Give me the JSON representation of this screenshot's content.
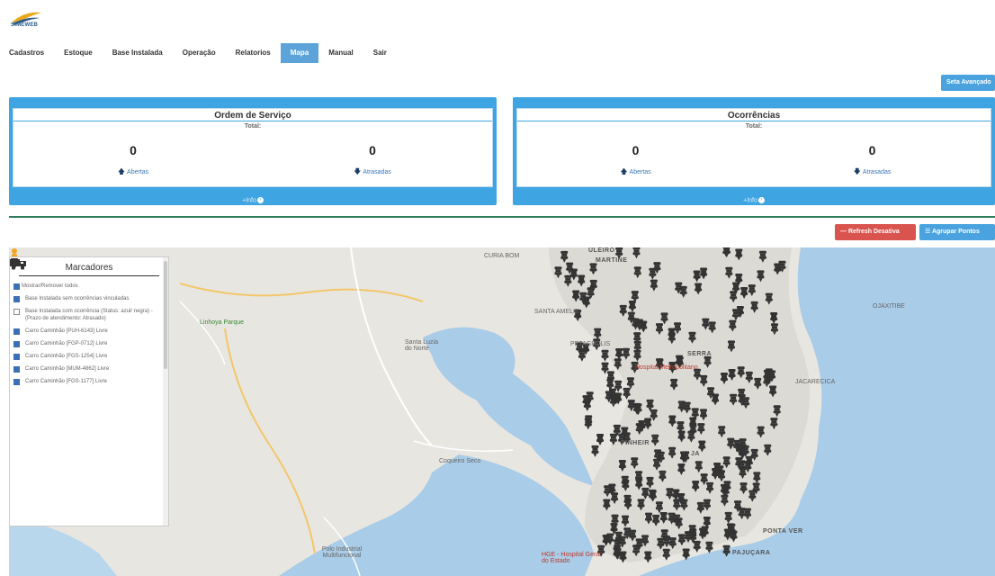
{
  "app": {
    "logo_text": "SIMEWEB"
  },
  "nav": {
    "items": [
      {
        "label": "Cadastros"
      },
      {
        "label": "Estoque"
      },
      {
        "label": "Base Instalada"
      },
      {
        "label": "Operação"
      },
      {
        "label": "Relatorios"
      },
      {
        "label": "Mapa",
        "active": true
      },
      {
        "label": "Manual"
      },
      {
        "label": "Sair"
      }
    ]
  },
  "buttons": {
    "advanced": "Seta Avançado",
    "refresh": "— Refresh Desativa",
    "group": "☰ Agrupar Pontos"
  },
  "ordem_servico": {
    "title": "Ordem de Serviço",
    "subtitle": "Total:",
    "abertas_value": "0",
    "abertas_label": "Abertas",
    "atrasadas_value": "0",
    "atrasadas_label": "Atrasadas",
    "footer": "+Info"
  },
  "ocorrencias": {
    "title": "Ocorrências",
    "subtitle": "Total:",
    "abertas_value": "0",
    "abertas_label": "Abertas",
    "atrasadas_value": "0",
    "atrasadas_label": "Atrasadas",
    "footer": "+Info"
  },
  "markers": {
    "title": "Marcadores",
    "items": [
      {
        "label": "Mostrar/Remover todos",
        "checked": true,
        "icon": "none"
      },
      {
        "label": "Base Instalada sem ocorrências vinculadas",
        "checked": true,
        "icon": "pin"
      },
      {
        "label": "Base Instalada com ocorrência (Status: azul/ negra) - (Prazo de atendimento: Atrasado)",
        "checked": false,
        "icon": "pin"
      },
      {
        "label": "Carro Caminhão [PUH-6143] Livre",
        "checked": true,
        "icon": "truck"
      },
      {
        "label": "Carro Caminhão [FGP-0712] Livre",
        "checked": true,
        "icon": "truck"
      },
      {
        "label": "Carro Caminhão [FGS-1254] Livre",
        "checked": true,
        "icon": "truck"
      },
      {
        "label": "Carro Caminhão [MUM-4862] Livre",
        "checked": true,
        "icon": "truck"
      },
      {
        "label": "Carro Caminhão [FGS-1177] Livre",
        "checked": true,
        "icon": "truck"
      }
    ]
  },
  "map": {
    "labels": [
      {
        "text": "CURIA BOM",
        "style": ""
      },
      {
        "text": "ULEIRO",
        "style": "bold"
      },
      {
        "text": "MARTINE",
        "style": "bold"
      },
      {
        "text": "SANTA AMELIE",
        "style": ""
      },
      {
        "text": "Linhoya Parque",
        "style": "green"
      },
      {
        "text": "Santa Luzia do Norte",
        "style": ""
      },
      {
        "text": "PETAGROLIS",
        "style": ""
      },
      {
        "text": "SERRA",
        "style": "bold"
      },
      {
        "text": "JACARECICA",
        "style": ""
      },
      {
        "text": "OJAXITIBE",
        "style": ""
      },
      {
        "text": "PINHEIR",
        "style": "bold"
      },
      {
        "text": "JA",
        "style": "bold"
      },
      {
        "text": "Coqueiro Seco",
        "style": ""
      },
      {
        "text": "PONTA VER",
        "style": "bold"
      },
      {
        "text": "PAJUÇARA",
        "style": "bold"
      },
      {
        "text": "Polo Industrial Multifuncional",
        "style": ""
      },
      {
        "text": "HGE - Hospital Geral do Estado",
        "style": "red"
      },
      {
        "text": "Hospital Metropolitano",
        "style": "red"
      }
    ]
  },
  "colors": {
    "nav_active": "#5ba3d8",
    "panel": "#3ea4e2",
    "refresh": "#d9534f",
    "divider": "#2f7d5b",
    "water": "#a9cce8",
    "land": "#e8e6e1",
    "marker": "#333333"
  }
}
